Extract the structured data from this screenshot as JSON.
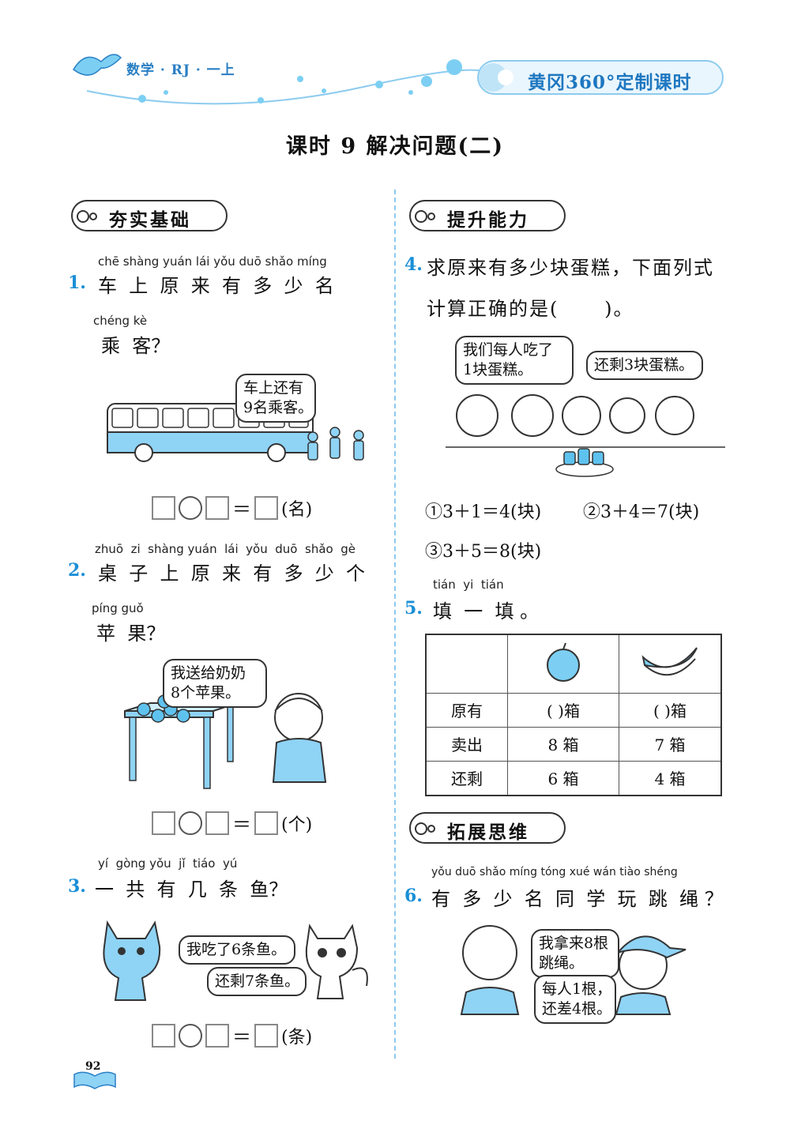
{
  "header": {
    "left": "数学 · RJ · 一上",
    "right": "黄冈360°定制课时"
  },
  "title": "课时 9   解决问题(二)",
  "sections": {
    "basic": "夯实基础",
    "improve": "提升能力",
    "expand": "拓展思维"
  },
  "q1": {
    "num": "1.",
    "pinyin1": "chē shàng yuán lái yǒu duō shǎo míng",
    "text1": "车  上  原  来  有  多  少  名",
    "pinyin2": "chéng kè",
    "text2": "乘  客？",
    "bubble": "车上还有\n9名乘客。",
    "unit": "(名)"
  },
  "q2": {
    "num": "2.",
    "pinyin1": "zhuō  zi  shàng yuán  lái  yǒu  duō  shǎo  gè",
    "text1": "桌  子  上  原  来  有  多  少  个",
    "pinyin2": "píng guǒ",
    "text2": "苹  果？",
    "bubble": "我送给奶奶\n8个苹果。",
    "unit": "(个)"
  },
  "q3": {
    "num": "3.",
    "pinyin1": "yí  gòng yǒu  jǐ  tiáo  yú",
    "text1": "一  共  有  几  条  鱼？",
    "bubble1": "我吃了6条鱼。",
    "bubble2": "还剩7条鱼。",
    "unit": "(条)"
  },
  "q4": {
    "num": "4.",
    "text1": "求原来有多少块蛋糕，下面列式",
    "text2": "计算正确的是(      )。",
    "bubble1": "我们每人吃了\n1块蛋糕。",
    "bubble2": "还剩3块蛋糕。",
    "opt1": "①3＋1＝4(块)",
    "opt2": "②3＋4＝7(块)",
    "opt3": "③3＋5＝8(块)"
  },
  "q5": {
    "num": "5.",
    "pinyin": "tián  yi  tián",
    "text": "填  一  填 。",
    "rows": [
      {
        "label": "原有",
        "c1": "(      )箱",
        "c2": "(      )箱"
      },
      {
        "label": "卖出",
        "c1": "8 箱",
        "c2": "7 箱"
      },
      {
        "label": "还剩",
        "c1": "6 箱",
        "c2": "4 箱"
      }
    ]
  },
  "q6": {
    "num": "6.",
    "pinyin": "yǒu duō shǎo míng tóng xué wán tiào shéng",
    "text": "有  多  少  名  同  学  玩  跳  绳 ？",
    "bubble1": "我拿来8根\n跳绳。",
    "bubble2": "每人1根，\n还差4根。"
  },
  "page_number": "92",
  "colors": {
    "accent": "#1a8fd6",
    "light_blue": "#8ccbef",
    "fill_blue": "#7ccff3"
  }
}
